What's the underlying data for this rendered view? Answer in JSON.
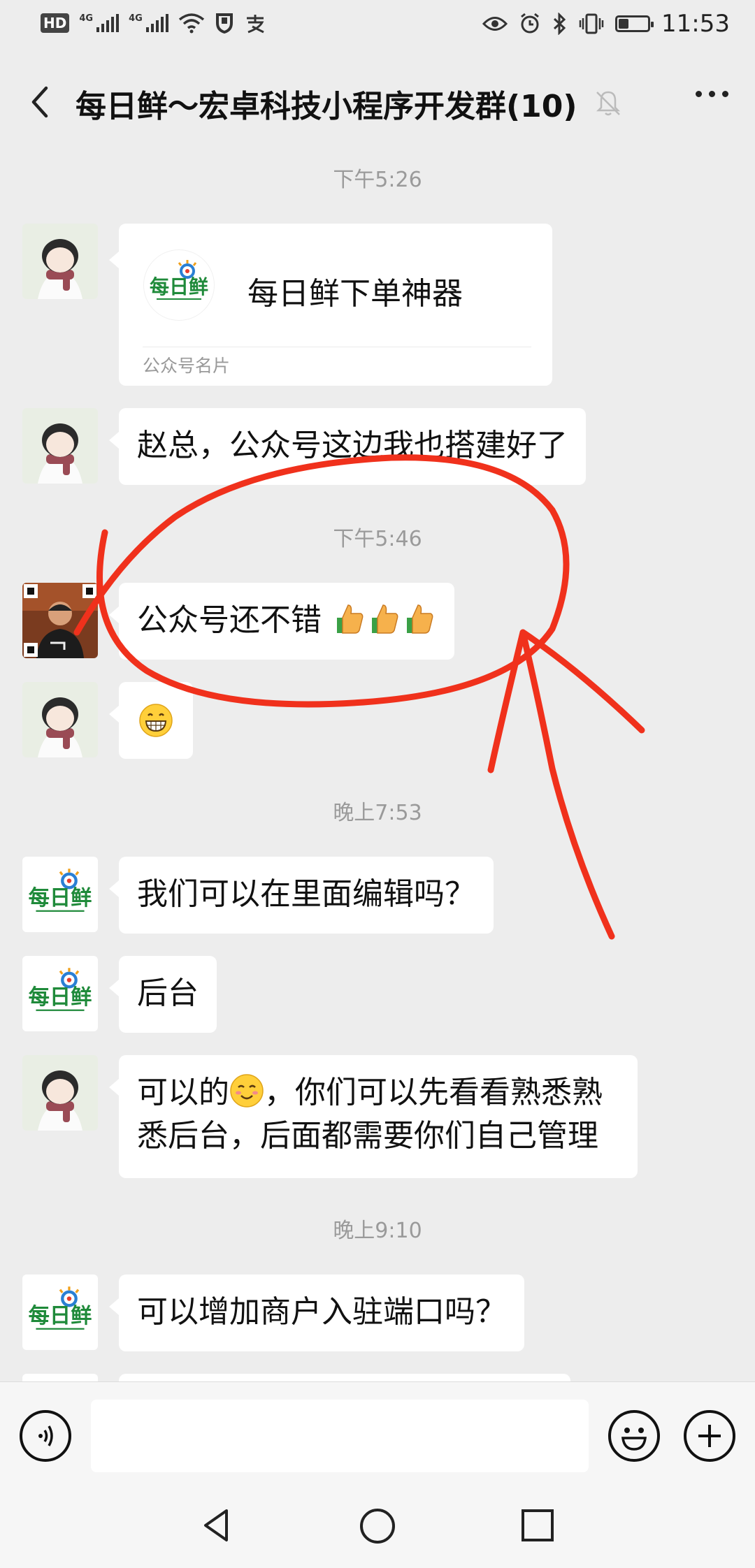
{
  "status_bar": {
    "hd_label": "HD",
    "sim1_label": "4G",
    "sim2_label": "4G",
    "time": "11:53"
  },
  "nav": {
    "title": "每日鲜～宏卓科技小程序开发群(10)"
  },
  "messages": {
    "t1": "下午5:26",
    "card_name": "每日鲜下单神器",
    "card_type": "公众号名片",
    "m1": "赵总，公众号这边我也搭建好了",
    "t2": "下午5:46",
    "m2": "公众号还不错",
    "t3": "晚上7:53",
    "m3": "我们可以在里面编辑吗？",
    "m4": "后台",
    "m5_a": "可以的",
    "m5_b": "，你们可以先看看熟悉熟",
    "m5_c": "悉后台，后面都需要你们自己管理",
    "t4": "晚上9:10",
    "m6": "可以增加商户入驻端口吗？"
  },
  "logo_text": "每日鲜",
  "colors": {
    "background": "#ededed",
    "bubble": "#ffffff",
    "annotation_red": "#f0311c",
    "logo_green": "#1f8a3a"
  }
}
